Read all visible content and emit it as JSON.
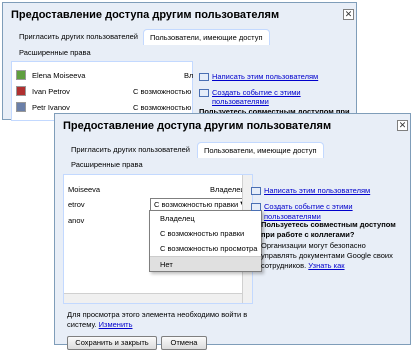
{
  "back_dialog": {
    "title": "Предоставление доступа другим пользователям",
    "close": "✕",
    "tabs": [
      "Пригласить других пользователей",
      "Пользователи, имеющие доступ",
      "Расширенные права"
    ],
    "users": [
      {
        "name": "Elena Moiseeva",
        "right": "Вл"
      },
      {
        "name": "Ivan Petrov",
        "right": "С возможностью"
      },
      {
        "name": "Petr Ivanov",
        "right": "С возможностью"
      }
    ],
    "links": [
      "Написать этим пользователям",
      "Создать событие с этими пользователями"
    ],
    "question": "Пользуетесь совместным доступом при",
    "note": "Для просм",
    "note2": "в систему."
  },
  "front_dialog": {
    "title": "Предоставление доступа другим пользователям",
    "close": "✕",
    "tabs": [
      "Пригласить других пользователей",
      "Пользователи, имеющие доступ",
      "Расширенные права"
    ],
    "users": [
      {
        "name": "Moiseeva",
        "right": "Владелец"
      },
      {
        "name": "etrov",
        "right": "С возможностью правки"
      },
      {
        "name": "anov",
        "right": ""
      }
    ],
    "dropdown_open": {
      "options": [
        "Владелец",
        "С возможностью правки",
        "С возможностью просмотра",
        "Нет"
      ],
      "highlighted": "Нет"
    },
    "links": [
      "Написать этим пользователям",
      "Создать событие с этими пользователями"
    ],
    "question": "Пользуетесь совместным доступом при работе с коллегами?",
    "info_text": "Организации могут безопасно управлять документами Google своих сотрудников.",
    "learn_more": "Узнать как",
    "footer_note": "Для просмотра этого элемента необходимо войти в систему.",
    "change_link": "Изменить",
    "buttons": [
      "Сохранить и закрыть",
      "Отмена"
    ],
    "arrow": "▼"
  }
}
